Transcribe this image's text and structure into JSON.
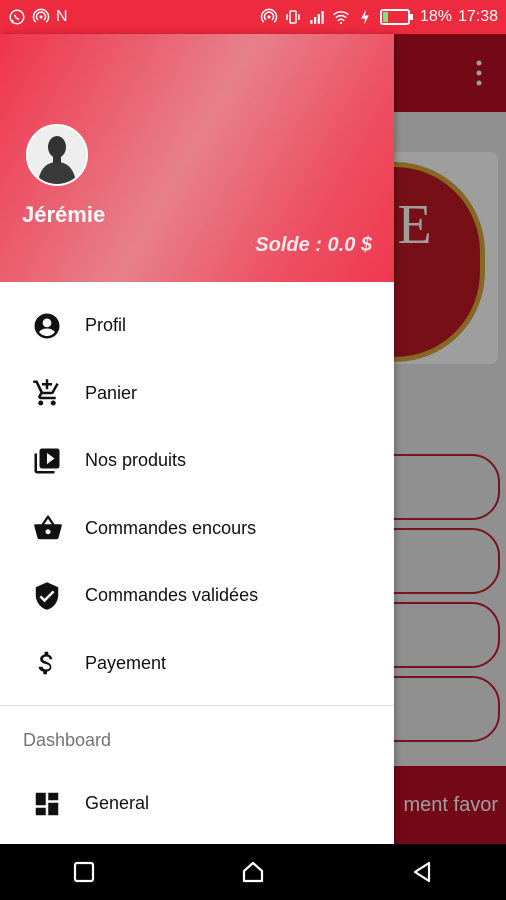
{
  "status_bar": {
    "carrier_letter": "N",
    "battery": "18%",
    "time": "17:38",
    "icons_left": [
      "whatsapp-icon",
      "hotspot-icon"
    ],
    "icons_right": [
      "hotspot-icon",
      "vibrate-icon",
      "signal-icon",
      "wifi-icon",
      "charging-icon",
      "battery-icon"
    ]
  },
  "drawer": {
    "user": {
      "name": "Jérémie",
      "balance": "Solde : 0.0 $"
    },
    "items": [
      {
        "label": "Profil",
        "icon": "account-circle-icon"
      },
      {
        "label": "Panier",
        "icon": "add-to-cart-icon"
      },
      {
        "label": "Nos produits",
        "icon": "video-library-icon"
      },
      {
        "label": "Commandes encours",
        "icon": "shopping-basket-icon"
      },
      {
        "label": "Commandes validées",
        "icon": "verified-shield-icon"
      },
      {
        "label": "Payement",
        "icon": "dollar-icon"
      }
    ],
    "section_title": "Dashboard",
    "section_items": [
      {
        "label": "General",
        "icon": "dashboard-icon"
      }
    ]
  },
  "background_app": {
    "footer_text": "ment favor",
    "card_text": "NE"
  },
  "colors": {
    "status_bar": "#ee2a3f",
    "header_gradient_start": "#f0344c",
    "app_toolbar": "#ba0f24"
  }
}
